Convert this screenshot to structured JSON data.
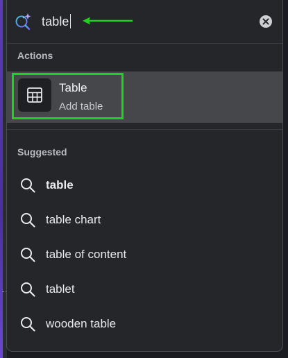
{
  "search": {
    "query": "table"
  },
  "actions": {
    "title": "Actions",
    "item": {
      "label": "Table",
      "sublabel": "Add table",
      "icon": "table-icon"
    }
  },
  "suggested": {
    "title": "Suggested",
    "items": [
      {
        "label": "table",
        "bold": true
      },
      {
        "label": "table chart"
      },
      {
        "label": "table of content"
      },
      {
        "label": "tablet"
      },
      {
        "label": "wooden table"
      }
    ]
  },
  "colors": {
    "annotation": "#1ed31e",
    "panel": "#252629",
    "hover_row": "#45474b",
    "accent_purple": "#5c3bb8"
  }
}
